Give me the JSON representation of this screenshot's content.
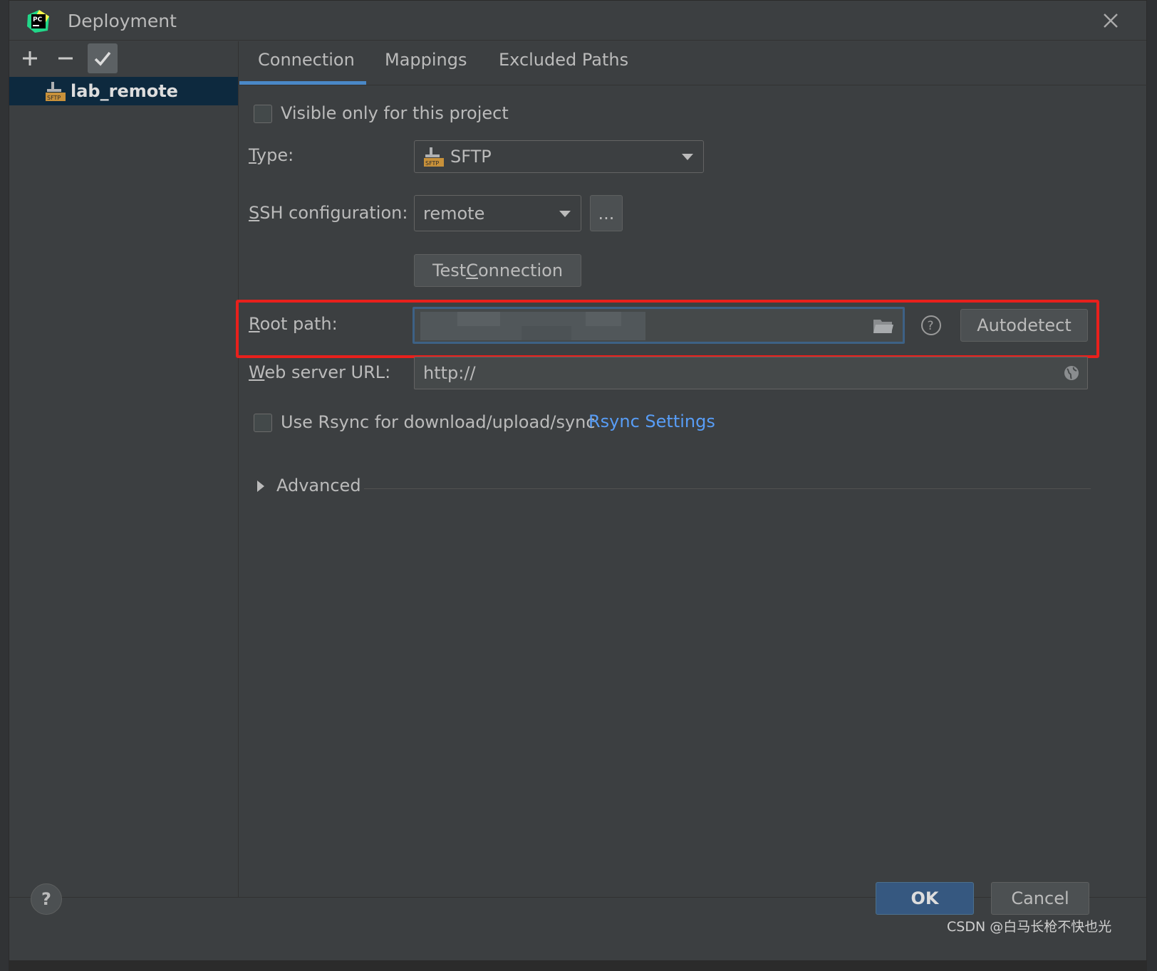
{
  "window": {
    "title": "Deployment"
  },
  "left_panel": {
    "items": [
      {
        "label": "lab_remote",
        "icon": "sftp-server-icon"
      }
    ]
  },
  "tabs": [
    {
      "label": "Connection",
      "selected": true
    },
    {
      "label": "Mappings",
      "selected": false
    },
    {
      "label": "Excluded Paths",
      "selected": false
    }
  ],
  "connection": {
    "visible_only_label": "Visible only for this project",
    "visible_only_checked": false,
    "type_label_mnemonic": "T",
    "type_label_rest": "ype:",
    "type_value": "SFTP",
    "ssh_label_mnemonic": "S",
    "ssh_label_rest": "SH configuration:",
    "ssh_value": "remote",
    "ssh_browse_label": "...",
    "test_label_pre": "Test ",
    "test_label_mnemonic": "C",
    "test_label_post": "onnection",
    "root_label_mnemonic": "R",
    "root_label_rest": "oot path:",
    "autodetect_label": "Autodetect",
    "web_label_mnemonic": "W",
    "web_label_rest": "eb server URL:",
    "web_value": "http://",
    "rsync_label": "Use Rsync for download/upload/sync",
    "rsync_checked": false,
    "rsync_settings_link": "Rsync Settings",
    "advanced_label": "Advanced"
  },
  "footer": {
    "help_label": "?",
    "ok_label": "OK",
    "cancel_label": "Cancel"
  },
  "watermark": "CSDN @白马长枪不快也光",
  "colors": {
    "accent": "#4a88c7",
    "highlight": "#e8201c",
    "link": "#589df6",
    "ok_button": "#365880"
  }
}
